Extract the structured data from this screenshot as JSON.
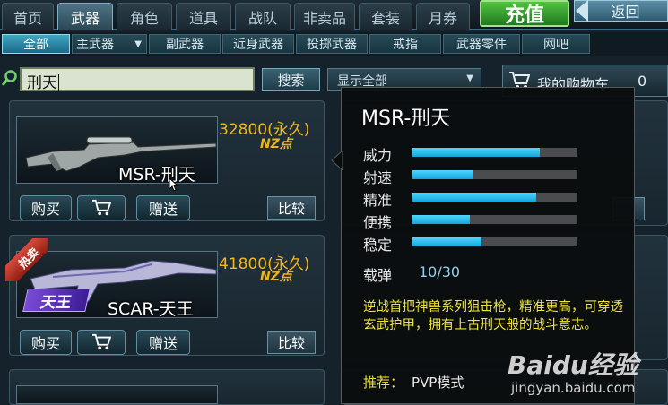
{
  "top_tabs": [
    "首页",
    "武器",
    "角色",
    "道具",
    "战队",
    "非卖品",
    "套装",
    "月券"
  ],
  "charge_label": "充值",
  "back_label": "返回",
  "sub_tabs": [
    "全部",
    "主武器",
    "副武器",
    "近身武器",
    "投掷武器",
    "戒指",
    "武器零件",
    "网吧"
  ],
  "search": {
    "value": "刑天",
    "button": "搜索"
  },
  "filter_label": "显示全部",
  "cart": {
    "label": "我的购物车",
    "count": "0"
  },
  "items": [
    {
      "name": "MSR-刑天",
      "price": "32800(永久)",
      "currency": "NZ点",
      "buy": "购买",
      "gift": "赠送",
      "compare": "比较",
      "badge": ""
    },
    {
      "name": "SCAR-天王",
      "price": "41800(永久)",
      "currency": "NZ点",
      "buy": "购买",
      "gift": "赠送",
      "compare": "比较",
      "badge": "热卖",
      "tag": "天王"
    }
  ],
  "tooltip": {
    "title": "MSR-刑天",
    "stats": [
      {
        "label": "威力",
        "value": 0.77
      },
      {
        "label": "射速",
        "value": 0.37
      },
      {
        "label": "精准",
        "value": 0.75
      },
      {
        "label": "便携",
        "value": 0.35
      },
      {
        "label": "稳定",
        "value": 0.42
      }
    ],
    "ammo_label": "载弹",
    "ammo_value": "10/30",
    "description": "逆战首把神兽系列狙击枪，精准更高，可穿透玄武护甲，拥有上古刑天般的战斗意志。",
    "recommend_label": "推荐：",
    "recommend_value": "PVP模式"
  },
  "watermark": {
    "brand": "Baidu经验",
    "url": "jingyan.baidu.com"
  },
  "colors": {
    "accent": "#1ab0e4",
    "price": "#f3b81a",
    "highlight_text": "#f0e43a"
  }
}
